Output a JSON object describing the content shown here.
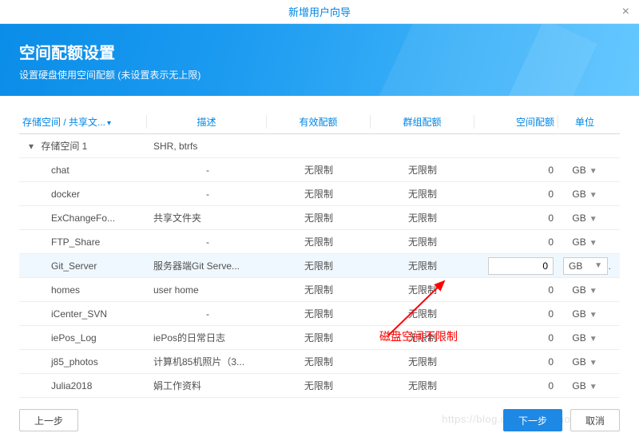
{
  "dialog": {
    "title": "新增用户向导"
  },
  "banner": {
    "heading": "空间配额设置",
    "subtitle": "设置硬盘使用空间配额 (未设置表示无上限)"
  },
  "columns": {
    "name": "存储空间 / 共享文...",
    "desc": "描述",
    "quota": "有效配额",
    "group": "群组配额",
    "space": "空间配额",
    "unit": "单位"
  },
  "rows": [
    {
      "name": "存储空间 1",
      "desc": "SHR, btrfs",
      "quota": "",
      "group": "",
      "space": "",
      "unit": "",
      "root": true
    },
    {
      "name": "chat",
      "desc": "-",
      "quota": "无限制",
      "group": "无限制",
      "space": "0",
      "unit": "GB"
    },
    {
      "name": "docker",
      "desc": "-",
      "quota": "无限制",
      "group": "无限制",
      "space": "0",
      "unit": "GB"
    },
    {
      "name": "ExChangeFo...",
      "desc": "共享文件夹",
      "quota": "无限制",
      "group": "无限制",
      "space": "0",
      "unit": "GB"
    },
    {
      "name": "FTP_Share",
      "desc": "-",
      "quota": "无限制",
      "group": "无限制",
      "space": "0",
      "unit": "GB"
    },
    {
      "name": "Git_Server",
      "desc": "服务器端Git Serve...",
      "quota": "无限制",
      "group": "无限制",
      "space": "0",
      "unit": "GB",
      "selected": true,
      "editing": true
    },
    {
      "name": "homes",
      "desc": "user home",
      "quota": "无限制",
      "group": "无限制",
      "space": "0",
      "unit": "GB"
    },
    {
      "name": "iCenter_SVN",
      "desc": "-",
      "quota": "无限制",
      "group": "无限制",
      "space": "0",
      "unit": "GB"
    },
    {
      "name": "iePos_Log",
      "desc": "iePos的日常日志",
      "quota": "无限制",
      "group": "无限制",
      "space": "0",
      "unit": "GB"
    },
    {
      "name": "j85_photos",
      "desc": "计算机85机照片（3...",
      "quota": "无限制",
      "group": "无限制",
      "space": "0",
      "unit": "GB"
    },
    {
      "name": "Julia2018",
      "desc": "娟工作资料",
      "quota": "无限制",
      "group": "无限制",
      "space": "0",
      "unit": "GB"
    }
  ],
  "footer": {
    "back": "上一步",
    "next": "下一步",
    "cancel": "取消"
  },
  "annotation": {
    "text": "磁盘空间不限制"
  },
  "watermark": "https://blog.csdn.net/shaofei_WU"
}
